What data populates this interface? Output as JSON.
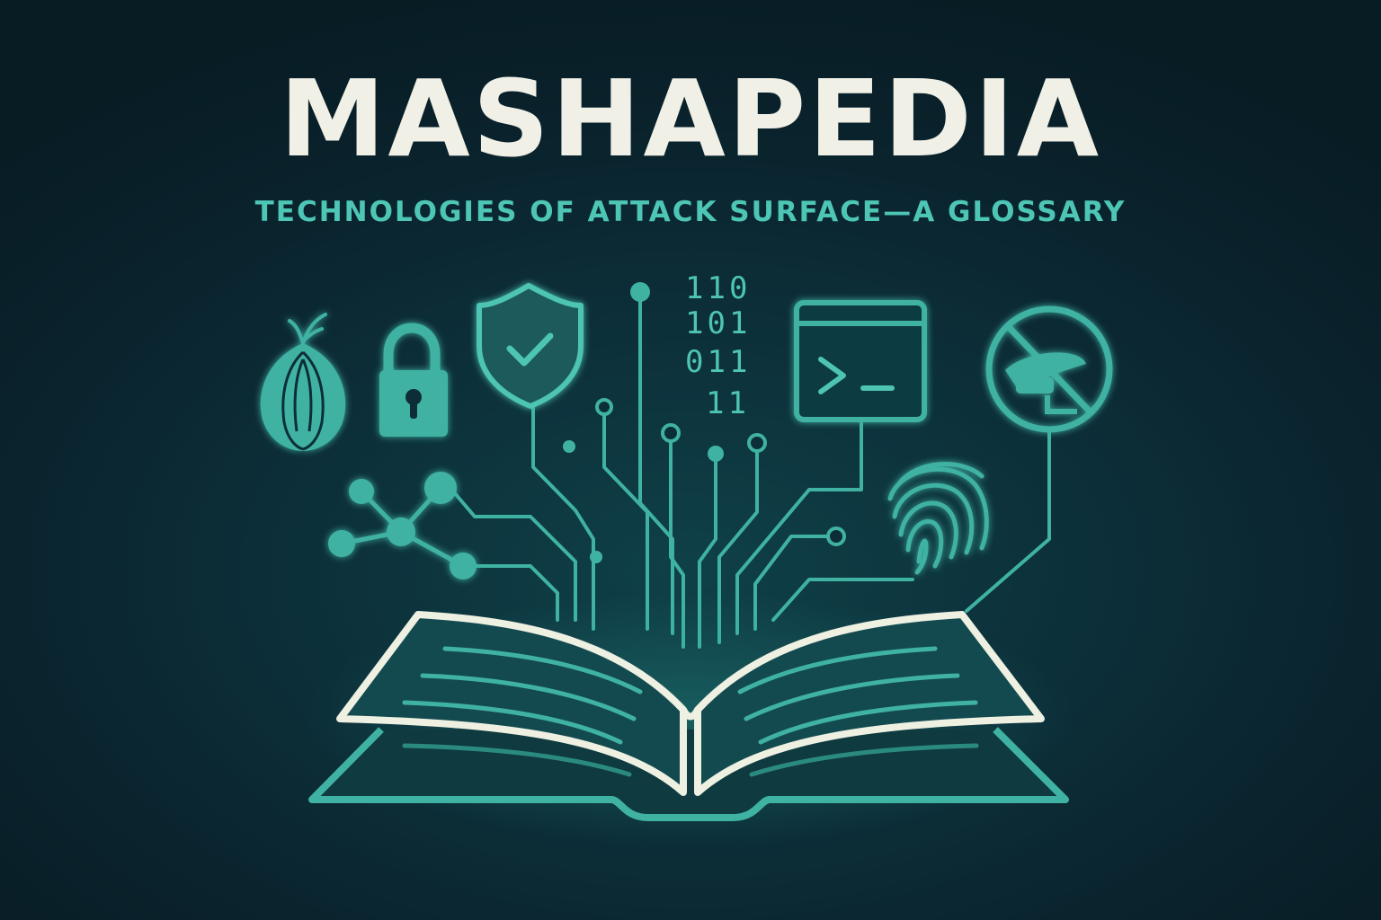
{
  "title": "MASHAPEDIA",
  "subtitle": "TECHNOLOGIES OF ATTACK SURFACE—A GLOSSARY",
  "binary_lines": [
    "110",
    "101",
    "011",
    "11"
  ],
  "icons": [
    "onion-icon",
    "padlock-icon",
    "shield-check-icon",
    "terminal-icon",
    "no-surveillance-camera-icon",
    "fingerprint-icon",
    "network-nodes-icon",
    "open-book-icon"
  ],
  "colors": {
    "background": "#0b2530",
    "accent": "#4ec4b4",
    "title": "#f0f0e6"
  }
}
